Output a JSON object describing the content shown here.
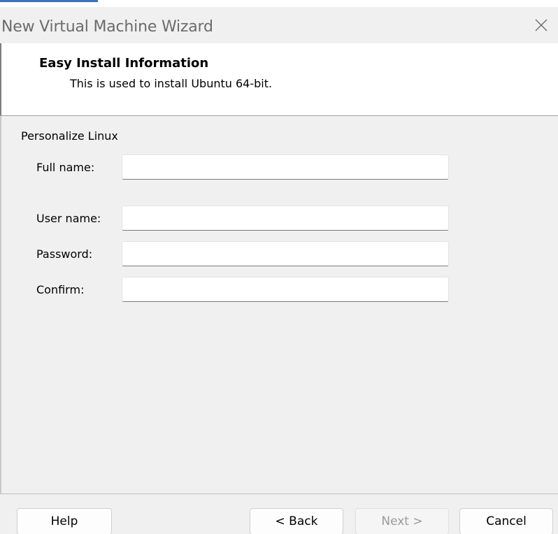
{
  "window": {
    "title": "New Virtual Machine Wizard",
    "close_icon": "close-icon"
  },
  "header": {
    "title": "Easy Install Information",
    "subtitle": "This is used to install Ubuntu 64-bit."
  },
  "form": {
    "section_label": "Personalize Linux",
    "fields": [
      {
        "label": "Full name:",
        "value": "",
        "placeholder": ""
      },
      {
        "label": "User name:",
        "value": "",
        "placeholder": ""
      },
      {
        "label": "Password:",
        "value": "",
        "placeholder": ""
      },
      {
        "label": "Confirm:",
        "value": "",
        "placeholder": ""
      }
    ]
  },
  "footer": {
    "help_label": "Help",
    "back_label": "< Back",
    "next_label": "Next >",
    "cancel_label": "Cancel"
  },
  "colors": {
    "window_bg": "#f0f0f0",
    "header_bg": "#ffffff",
    "disabled_text": "#9a9a9a"
  }
}
